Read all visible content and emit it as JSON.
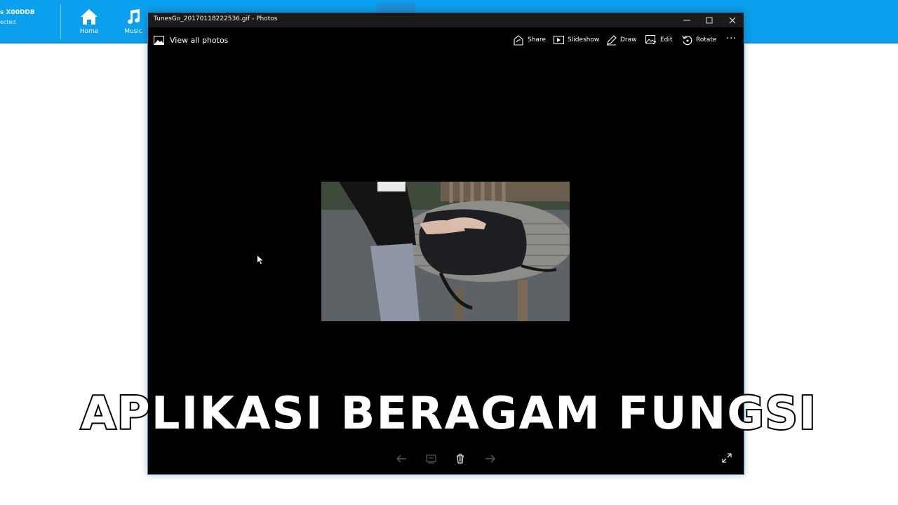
{
  "background_app": {
    "device_name": "s X00DDB",
    "device_status": "ected",
    "nav": [
      {
        "label": "Home",
        "icon": "home-icon"
      },
      {
        "label": "Music",
        "icon": "music-note-icon"
      }
    ],
    "accent": "#0aa0ee"
  },
  "window": {
    "title": "TunesGo_20170118222536.gif - Photos",
    "controls": {
      "minimize": "–",
      "maximize": "☐",
      "close": "✕"
    }
  },
  "toolbar": {
    "view_all": "View all photos",
    "share": "Share",
    "slideshow": "Slideshow",
    "draw": "Draw",
    "edit": "Edit",
    "rotate": "Rotate",
    "more": "···"
  },
  "photo": {
    "description_icon": "photo-image"
  },
  "bottom_controls": [
    "arrow-left-icon",
    "gallery-icon",
    "trash-icon",
    "arrow-right-icon",
    "fullscreen-icon"
  ],
  "caption": "APLIKASI BERAGAM FUNGSI"
}
